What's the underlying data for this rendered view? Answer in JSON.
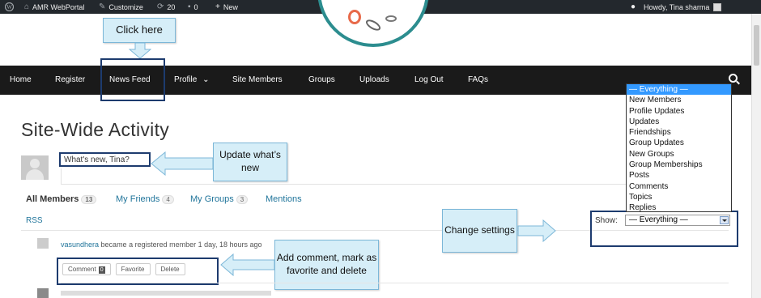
{
  "adminbar": {
    "site_name": "AMR WebPortal",
    "customize": "Customize",
    "updates_count": "20",
    "comments_count": "0",
    "new_label": "New",
    "greeting": "Howdy, Tina sharma"
  },
  "nav": {
    "items": [
      "Home",
      "Register",
      "News Feed",
      "Profile",
      "Site Members",
      "Groups",
      "Uploads",
      "Log Out",
      "FAQs"
    ],
    "profile_caret": "⌄"
  },
  "callouts": {
    "click_here": "Click here",
    "update_whats_new": "Update what’s new",
    "change_settings": "Change settings",
    "add_comment": "Add comment, mark as favorite and delete"
  },
  "page_title": "Site-Wide Activity",
  "whats_new_placeholder": "What's new, Tina?",
  "tabs": [
    {
      "label": "All Members",
      "count": "13"
    },
    {
      "label": "My Friends",
      "count": "4"
    },
    {
      "label": "My Groups",
      "count": "3"
    },
    {
      "label": "Mentions",
      "count": ""
    }
  ],
  "rss_label": "RSS",
  "activity": {
    "user": "vasundhera",
    "text": " became a registered member 1 day, 18 hours ago"
  },
  "activity_buttons": {
    "comment": "Comment",
    "comment_count": "0",
    "favorite": "Favorite",
    "delete": "Delete"
  },
  "filter": {
    "show_label": "Show:",
    "selected": "— Everything —",
    "options": [
      "— Everything —",
      "New Members",
      "Profile Updates",
      "Updates",
      "Friendships",
      "Group Updates",
      "New Groups",
      "Group Memberships",
      "Posts",
      "Comments",
      "Topics",
      "Replies"
    ]
  },
  "colors": {
    "adminbar_bg": "#23282d",
    "nav_bg": "#1a1a1a",
    "link": "#21759b",
    "callout_bg": "#d6eef8",
    "highlight_border": "#1d3b6e",
    "dropdown_selected": "#3399ff",
    "logo_ring": "#2c8d8f"
  }
}
